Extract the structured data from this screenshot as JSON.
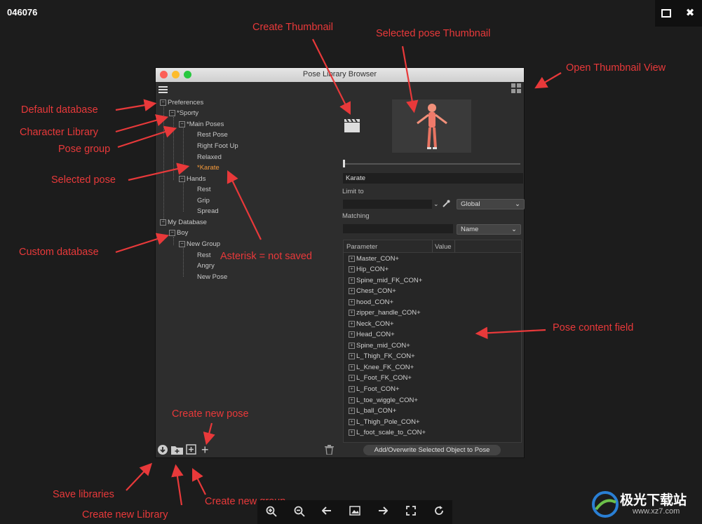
{
  "viewer": {
    "title": "046076",
    "maximize_icon": "maximize-icon",
    "close_icon": "close-icon"
  },
  "window": {
    "title": "Pose Library Browser"
  },
  "tree": [
    {
      "label": "Preferences"
    },
    {
      "label": "*Sporty"
    },
    {
      "label": "*Main Poses"
    },
    {
      "label": "Rest Pose"
    },
    {
      "label": "Right Foot Up"
    },
    {
      "label": "Relaxed"
    },
    {
      "label": "*Karate"
    },
    {
      "label": "Hands"
    },
    {
      "label": "Rest"
    },
    {
      "label": "Grip"
    },
    {
      "label": "Spread"
    },
    {
      "label": "My Database"
    },
    {
      "label": "Boy"
    },
    {
      "label": "New Group"
    },
    {
      "label": "Rest"
    },
    {
      "label": "Angry"
    },
    {
      "label": "New Pose"
    }
  ],
  "right": {
    "pose_name": "Karate",
    "limit_to_label": "Limit to",
    "limit_dropdown": "Global",
    "matching_label": "Matching",
    "matching_dropdown": "Name",
    "col_parameter": "Parameter",
    "col_value": "Value",
    "add_button": "Add/Overwrite Selected Object to Pose"
  },
  "params": [
    "Master_CON+",
    "Hip_CON+",
    "Spine_mid_FK_CON+",
    "Chest_CON+",
    "hood_CON+",
    "zipper_handle_CON+",
    "Neck_CON+",
    "Head_CON+",
    "Spine_mid_CON+",
    "L_Thigh_FK_CON+",
    "L_Knee_FK_CON+",
    "L_Foot_FK_CON+",
    "L_Foot_CON+",
    "L_toe_wiggle_CON+",
    "L_ball_CON+",
    "L_Thigh_Pole_CON+",
    "L_foot_scale_to_CON+"
  ],
  "annotations": {
    "create_thumbnail": "Create Thumbnail",
    "selected_pose_thumbnail": "Selected pose Thumbnail",
    "open_thumbnail_view": "Open Thumbnail View",
    "default_database": "Default database",
    "character_library": "Character Library",
    "pose_group": "Pose group",
    "selected_pose": "Selected pose",
    "custom_database": "Custom database",
    "asterisk": "Asterisk = not saved",
    "pose_content_field": "Pose content field",
    "create_new_pose": "Create new pose",
    "save_libraries": "Save libraries",
    "create_new_library": "Create new Library",
    "create_new_group": "Create new group"
  },
  "watermark": {
    "cn": "极光下载站",
    "url": "www.xz7.com"
  }
}
